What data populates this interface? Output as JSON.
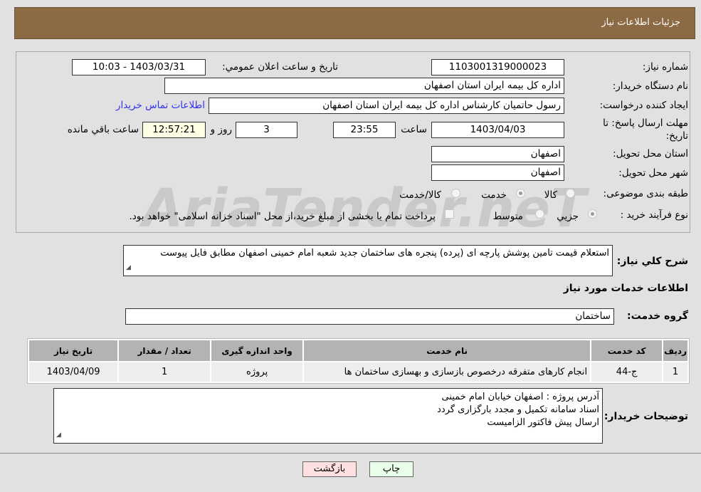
{
  "header": {
    "title": "جزئیات اطلاعات نیاز"
  },
  "watermark": "AriaTender.neT",
  "form": {
    "need_number_label": "شماره نیاز:",
    "need_number": "1103001319000023",
    "announce_label": "تاريخ و ساعت اعلان عمومي:",
    "announce_value": "1403/03/31 - 10:03",
    "buyer_org_label": "نام دستگاه خریدار:",
    "buyer_org": "اداره کل بیمه ایران استان اصفهان",
    "creator_label": "ایجاد کننده درخواست:",
    "creator": "رسول  حاتمیان کارشناس اداره کل بیمه ایران استان اصفهان",
    "contact_link": "اطلاعات تماس خریدار",
    "deadline_label": "مهلت ارسال پاسخ: تا تاریخ:",
    "deadline_date": "1403/04/03",
    "time_label": "ساعت",
    "deadline_time": "23:55",
    "days": "3",
    "days_label": "روز و",
    "remaining": "12:57:21",
    "remaining_label": "ساعت باقي مانده",
    "province_label": "استان محل تحویل:",
    "province": "اصفهان",
    "city_label": "شهر محل تحویل:",
    "city": "اصفهان",
    "category_label": "طبقه بندی موضوعی:",
    "category_options": [
      "کالا",
      "خدمت",
      "کالا/خدمت"
    ],
    "category_selected": "خدمت",
    "process_label": "نوع فرآیند خرید :",
    "process_options": [
      "جزيي",
      "متوسط"
    ],
    "process_selected": "جزيي",
    "payment_note": "پرداخت تمام یا بخشی از مبلغ خرید،از محل \"اسناد خزانه اسلامی\" خواهد بود."
  },
  "description": {
    "label": "شرح کلي نیاز:",
    "text": "استعلام قیمت تامین پوشش پارچه ای (پرده) پنجره های ساختمان جدید شعبه امام خمینی اصفهان مطابق فایل پیوست"
  },
  "services": {
    "title": "اطلاعات خدمات مورد نیاز",
    "group_label": "گروه خدمت:",
    "group": "ساختمان",
    "columns": [
      "ردیف",
      "کد خدمت",
      "نام خدمت",
      "واحد اندازه گیری",
      "تعداد / مقدار",
      "تاریخ نیاز"
    ],
    "rows": [
      [
        "1",
        "ج-44",
        "انجام کارهای متفرقه درخصوص بازسازی و بهسازی ساختمان ها",
        "پروژه",
        "1",
        "1403/04/09"
      ]
    ]
  },
  "buyer_notes": {
    "label": "توضیحات خریدار:",
    "lines": [
      "آدرس پروژه : اصفهان خیابان امام خمینی",
      "اسناد سامانه تکمیل و مجدد بارگزاری گردد",
      "ارسال پیش فاکتور الزامیست"
    ]
  },
  "buttons": {
    "print": "چاپ",
    "back": "بازگشت"
  }
}
